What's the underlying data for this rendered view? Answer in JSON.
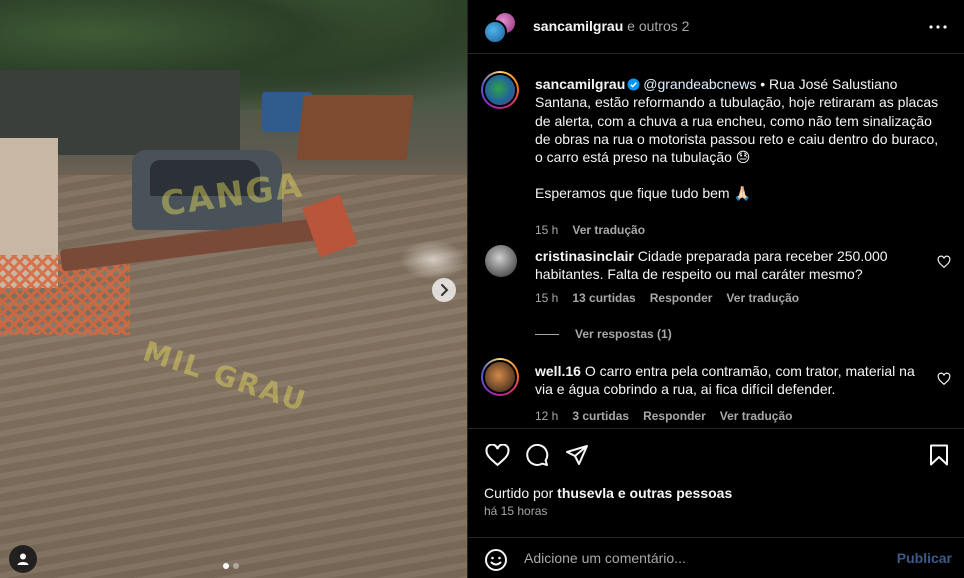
{
  "media": {
    "watermark_1": "CANGA",
    "watermark_2": "MIL GRAU",
    "carousel": {
      "count": 2,
      "active_index": 0
    }
  },
  "header": {
    "username": "sancamilgrau",
    "collab_text": "e outros 2"
  },
  "caption": {
    "username": "sancamilgrau",
    "mention": "@grandeabcnews",
    "text": " • Rua José Salustiano Santana, estão reformando a tubulação, hoje retiraram as placas de alerta, com a chuva a rua encheu, como não tem sinalização de obras na rua o motorista passou reto e caiu dentro do buraco, o carro está preso na tubulação 😓",
    "text_2": "Esperamos que fique tudo bem 🙏🏻",
    "time": "15 h",
    "translate": "Ver tradução"
  },
  "comments": [
    {
      "username": "cristinasinclair",
      "text": "Cidade preparada para receber 250.000 habitantes. Falta de respeito ou mal caráter mesmo?",
      "time": "15 h",
      "likes": "13 curtidas",
      "reply": "Responder",
      "translate": "Ver tradução",
      "view_replies": "Ver respostas (1)"
    },
    {
      "username": "well.16",
      "text": "O carro entra pela contramão, com trator, material na via e água cobrindo a rua, ai fica difícil defender.",
      "time": "12 h",
      "likes": "3 curtidas",
      "reply": "Responder",
      "translate": "Ver tradução"
    }
  ],
  "likes": {
    "prefix": "Curtido por",
    "user": "thusevla",
    "suffix": "e outras pessoas"
  },
  "posted_time": "há 15 horas",
  "add_comment": {
    "placeholder": "Adicione um comentário...",
    "publish_label": "Publicar"
  },
  "icons": {
    "verified": "verified-badge-icon",
    "more": "more-options-icon",
    "like": "heart-icon",
    "comment": "comment-icon",
    "share": "share-icon",
    "save": "bookmark-icon",
    "emoji": "emoji-icon",
    "next": "chevron-right-icon",
    "tag": "user-tag-icon"
  },
  "colors": {
    "background": "#000000",
    "text": "#f5f5f5",
    "secondary": "#a8a8a8",
    "verified": "#0095f6",
    "publish_disabled": "#3b5a84"
  }
}
